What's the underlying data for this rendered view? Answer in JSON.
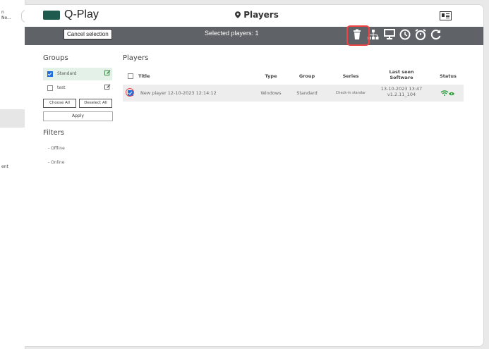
{
  "leftbar": {
    "top_text_1": "n",
    "top_text_2": "No...",
    "bottom_text": "ent"
  },
  "app": {
    "logo_text": "Q-Play",
    "page_title": "Players"
  },
  "actionbar": {
    "cancel_label": "Cancel selection",
    "selected_text": "Selected players: 1",
    "icons": [
      "trash-icon",
      "network-icon",
      "presentation-icon",
      "clock-icon",
      "alarm-icon",
      "refresh-icon"
    ]
  },
  "groups": {
    "title": "Groups",
    "items": [
      {
        "label": "Standard",
        "checked": true
      },
      {
        "label": "test",
        "checked": false
      }
    ],
    "choose_all": "Choose All",
    "deselect_all": "Deselect All",
    "apply": "Apply"
  },
  "filters": {
    "title": "Filters",
    "items": [
      "- Offline",
      "- Online"
    ]
  },
  "players": {
    "title": "Players",
    "columns": {
      "title": "Title",
      "type": "Type",
      "group": "Group",
      "series": "Series",
      "last_seen": "Last seen",
      "software": "Software",
      "status": "Status"
    },
    "rows": [
      {
        "title": "New player 12-10-2023 12:14:12",
        "type": "Windows",
        "group": "Standard",
        "series": "Check-in standar",
        "last_seen": "13-10-2023 13:47",
        "software": "v1.2.11_104",
        "checked": true
      }
    ]
  },
  "colors": {
    "accent": "#1f5a4f",
    "status": "#2e9c3a",
    "highlight": "#e44444",
    "actionbar": "#5f6266"
  }
}
